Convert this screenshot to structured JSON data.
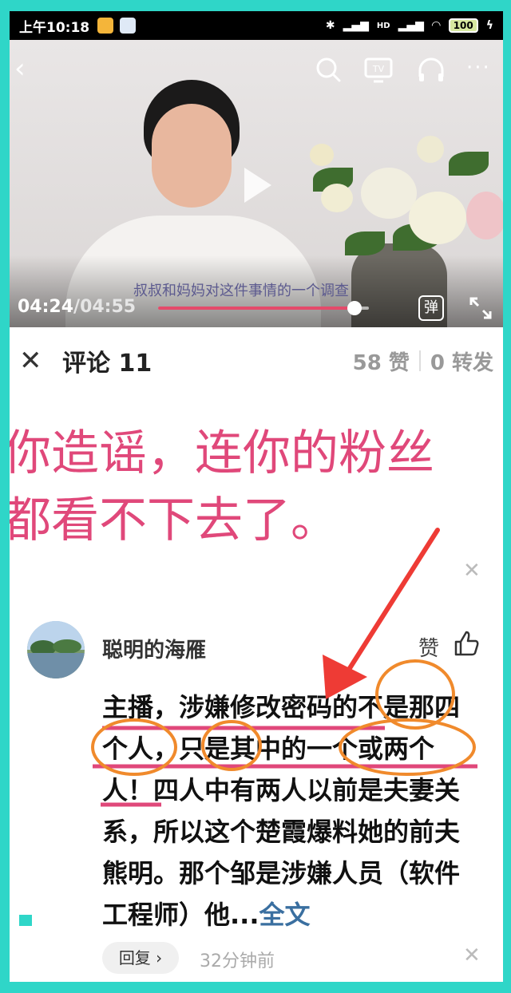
{
  "status_bar": {
    "time": "上午10:18",
    "network_tag": "HD",
    "battery": "100"
  },
  "video": {
    "subtitle": "叔叔和妈妈对这件事情的一个调查",
    "time_current": "04:24",
    "time_total": "/04:55",
    "progress": 0.93,
    "danmu_label": "弹"
  },
  "comments_header": {
    "title": "评论 11",
    "likes": "58 赞",
    "shares": "0 转发"
  },
  "overlay": {
    "line1": "你造谣，连你的粉丝",
    "line2": "都看不下去了。"
  },
  "comment": {
    "username": "聪明的海雁",
    "like_label": "赞",
    "text": "主播，涉嫌修改密码的不是那四个人，只是其中的一个或两个人！四人中有两人以前是夫妻关系，所以这个楚霞爆料她的前夫熊明。那个邹是涉嫌人员（软件工程师）他...",
    "more_label": "全文",
    "reply_label": "回复 ›",
    "time": "32分钟前"
  },
  "colors": {
    "accent_pink": "#e0487a",
    "frame_teal": "#2fd6c8",
    "link_blue": "#3a6fa0"
  }
}
